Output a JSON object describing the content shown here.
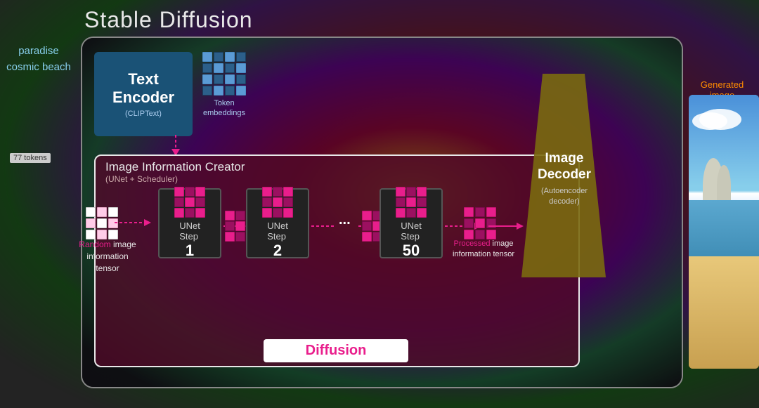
{
  "title": "Stable Diffusion",
  "prompt": {
    "text": "paradise\ncosmic\nbeach",
    "tokens": "77 tokens"
  },
  "text_encoder": {
    "label": "Text\nEncoder",
    "sublabel": "(CLIPText)",
    "token_label": "Token\nembeddings"
  },
  "image_info_creator": {
    "title": "Image Information Creator",
    "subtitle": "(UNet + Scheduler)"
  },
  "random_tensor": {
    "label_prefix": "Random",
    "label_suffix": " image\ninformation tensor"
  },
  "processed_tensor": {
    "label_prefix": "Processed",
    "label_suffix": " image\ninformation tensor"
  },
  "unet_steps": [
    {
      "label": "UNet\nStep",
      "number": "1"
    },
    {
      "label": "UNet\nStep",
      "number": "2"
    },
    {
      "label": "UNet\nStep",
      "number": "50"
    }
  ],
  "dots": "...",
  "diffusion": "Diffusion",
  "decoder": {
    "label": "Image\nDecoder",
    "sublabel": "(Autoencoder\ndecoder)"
  },
  "generated_image": {
    "label": "Generated\nimage"
  },
  "colors": {
    "pink": "#e91e8c",
    "orange": "#ff8c00",
    "blue_dark": "#1a5276"
  }
}
